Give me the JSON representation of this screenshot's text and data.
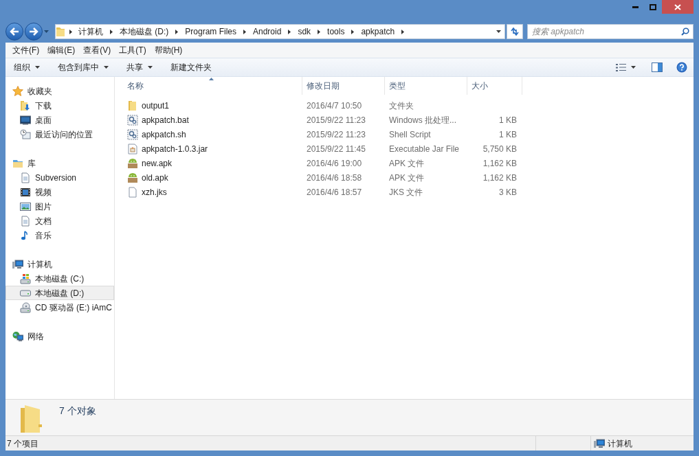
{
  "address_bar": {
    "path": [
      "计算机",
      "本地磁盘 (D:)",
      "Program Files",
      "Android",
      "sdk",
      "tools",
      "apkpatch"
    ]
  },
  "search": {
    "placeholder": "搜索 apkpatch"
  },
  "menu_bar": [
    "文件(F)",
    "编辑(E)",
    "查看(V)",
    "工具(T)",
    "帮助(H)"
  ],
  "toolbar": [
    {
      "label": "组织",
      "dropdown": true
    },
    {
      "label": "包含到库中",
      "dropdown": true
    },
    {
      "label": "共享",
      "dropdown": true
    },
    {
      "label": "新建文件夹",
      "dropdown": false
    }
  ],
  "sidebar": {
    "groups": [
      {
        "label": "收藏夹",
        "kind": "star",
        "children": [
          {
            "label": "下载",
            "kind": "download",
            "selected": false
          },
          {
            "label": "桌面",
            "kind": "desktop",
            "selected": false
          },
          {
            "label": "最近访问的位置",
            "kind": "recent",
            "selected": false
          }
        ]
      },
      {
        "label": "库",
        "kind": "library",
        "children": [
          {
            "label": "Subversion",
            "kind": "doc",
            "selected": false
          },
          {
            "label": "视频",
            "kind": "video",
            "selected": false
          },
          {
            "label": "图片",
            "kind": "picture",
            "selected": false
          },
          {
            "label": "文档",
            "kind": "doc",
            "selected": false
          },
          {
            "label": "音乐",
            "kind": "music",
            "selected": false
          }
        ]
      },
      {
        "label": "计算机",
        "kind": "computer",
        "children": [
          {
            "label": "本地磁盘 (C:)",
            "kind": "sysdrive",
            "selected": false
          },
          {
            "label": "本地磁盘 (D:)",
            "kind": "drive",
            "selected": true
          },
          {
            "label": "CD 驱动器 (E:) iAmC",
            "kind": "cd",
            "selected": false
          }
        ]
      },
      {
        "label": "网络",
        "kind": "network"
      }
    ]
  },
  "file_list": {
    "columns": [
      "名称",
      "修改日期",
      "类型",
      "大小"
    ],
    "rows": [
      {
        "name": "output1",
        "kind": "folder",
        "modified": "2016/4/7 10:50",
        "type": "文件夹",
        "size": ""
      },
      {
        "name": "apkpatch.bat",
        "kind": "script",
        "modified": "2015/9/22 11:23",
        "type": "Windows 批处理...",
        "size": "1 KB"
      },
      {
        "name": "apkpatch.sh",
        "kind": "script",
        "modified": "2015/9/22 11:23",
        "type": "Shell Script",
        "size": "1 KB"
      },
      {
        "name": "apkpatch-1.0.3.jar",
        "kind": "jar",
        "modified": "2015/9/22 11:45",
        "type": "Executable Jar File",
        "size": "5,750 KB"
      },
      {
        "name": "new.apk",
        "kind": "apk",
        "modified": "2016/4/6 19:00",
        "type": "APK 文件",
        "size": "1,162 KB"
      },
      {
        "name": "old.apk",
        "kind": "apk",
        "modified": "2016/4/6 18:58",
        "type": "APK 文件",
        "size": "1,162 KB"
      },
      {
        "name": "xzh.jks",
        "kind": "file",
        "modified": "2016/4/6 18:57",
        "type": "JKS 文件",
        "size": "3 KB"
      }
    ]
  },
  "details_pane": {
    "text": "7 个对象"
  },
  "status_bar": {
    "count": "7 个项目",
    "location": "计算机"
  }
}
